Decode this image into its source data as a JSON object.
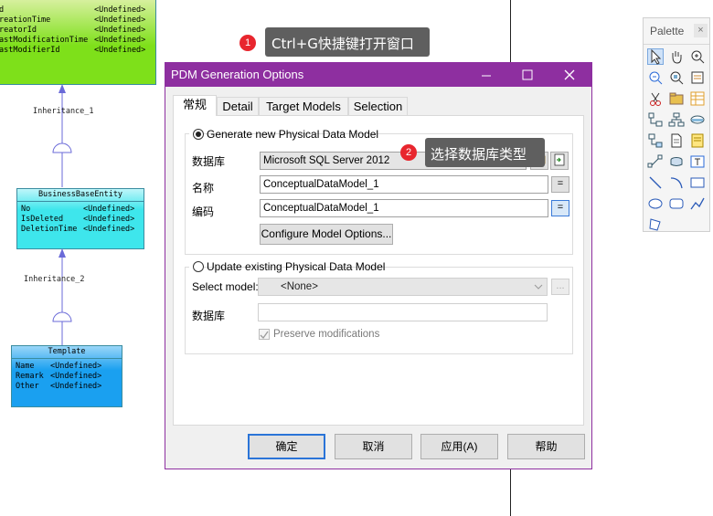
{
  "diagram": {
    "entity_top": {
      "rows": [
        {
          "attr": "d",
          "type": "<Undefined>"
        },
        {
          "attr": "reationTime",
          "type": "<Undefined>"
        },
        {
          "attr": "reatorId",
          "type": "<Undefined>"
        },
        {
          "attr": "astModificationTime",
          "type": "<Undefined>"
        },
        {
          "attr": "astModifierId",
          "type": "<Undefined>"
        }
      ]
    },
    "inheritance_1": "Inheritance_1",
    "business_base": {
      "title": "BusinessBaseEntity",
      "rows": [
        {
          "attr": "No",
          "type": "<Undefined>"
        },
        {
          "attr": "IsDeleted",
          "type": "<Undefined>"
        },
        {
          "attr": "DeletionTime",
          "type": "<Undefined>"
        }
      ]
    },
    "inheritance_2": "Inheritance_2",
    "template": {
      "title": "Template",
      "rows": [
        {
          "attr": "Name",
          "type": "<Undefined>"
        },
        {
          "attr": "Remark",
          "type": "<Undefined>"
        },
        {
          "attr": "Other",
          "type": "<Undefined>"
        }
      ]
    }
  },
  "callouts": {
    "one": {
      "number": "1",
      "text": "Ctrl+G快捷键打开窗口"
    },
    "two": {
      "number": "2",
      "text": "选择数据库类型"
    }
  },
  "palette": {
    "title": "Palette",
    "close": "×",
    "tools": [
      "pointer-icon",
      "grabber-icon",
      "zoom-in-icon",
      "zoom-out-icon",
      "zoom-fit-icon",
      "properties-icon",
      "cut-icon",
      "package-icon",
      "table-icon",
      "reference-icon",
      "hierarchy-icon",
      "view-icon",
      "procedure-icon",
      "file-icon",
      "note-icon",
      "link-icon",
      "database-icon",
      "text-icon",
      "line-icon",
      "arc-icon",
      "rectangle-icon",
      "ellipse-icon",
      "rounded-rect-icon",
      "polyline-icon",
      "polygon-icon"
    ]
  },
  "dialog": {
    "title": "PDM Generation Options",
    "tabs": [
      "常规",
      "Detail",
      "Target Models",
      "Selection"
    ],
    "generate_new": {
      "label": "Generate new Physical Data Model",
      "dbms_label": "数据库",
      "dbms_value": "Microsoft SQL Server 2012",
      "name_label": "名称",
      "name_value": "ConceptualDataModel_1",
      "code_label": "编码",
      "code_value": "ConceptualDataModel_1",
      "equals": "=",
      "configure": "Configure Model Options..."
    },
    "update_existing": {
      "label": "Update existing Physical Data Model",
      "select_label": "Select model:",
      "select_value": "<None>",
      "ellipsis": "...",
      "dbms_label": "数据库",
      "dbms_value": "",
      "preserve": "Preserve modifications"
    },
    "buttons": {
      "ok": "确定",
      "cancel": "取消",
      "apply": "应用(A)",
      "help": "帮助"
    }
  },
  "colors": {
    "accent": "#8e2fa0",
    "entity_green_top": "#d8f0a0",
    "entity_green_bottom": "#7ee01a",
    "entity_cyan": "#3ee6ec",
    "entity_blue": "#1aa0f0",
    "callout_bg": "#5f5f5f",
    "badge": "#e8262e"
  }
}
